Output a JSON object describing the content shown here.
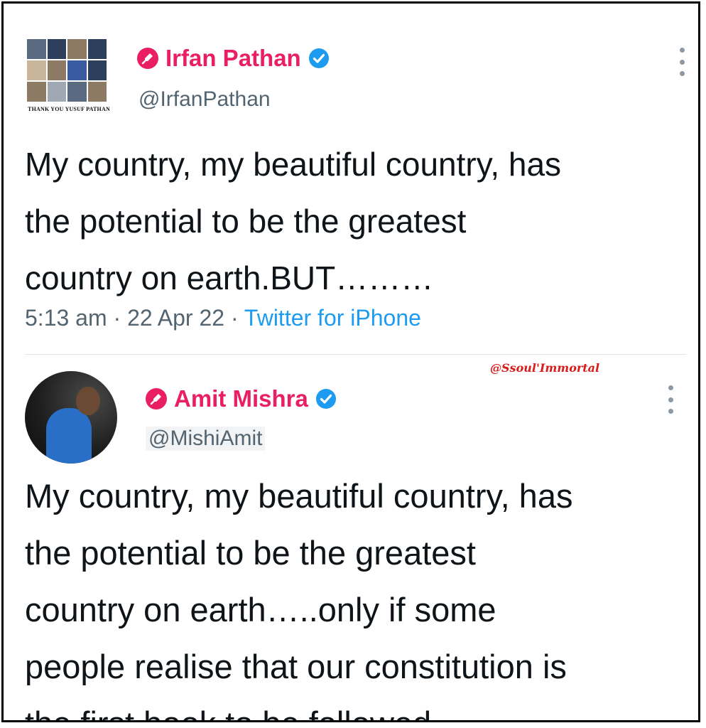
{
  "tweets": [
    {
      "display_name": "Irfan Pathan",
      "handle": "@IrfanPathan",
      "avatar_caption": "THANK YOU YUSUF PATHAN",
      "text_lines": [
        "My country, my beautiful country, has",
        "the potential to be the greatest",
        "country on earth.BUT………"
      ],
      "time": "5:13 am",
      "date": "22 Apr 22",
      "separator": "·",
      "source": "Twitter for iPhone"
    },
    {
      "display_name": "Amit Mishra",
      "handle": "@MishiAmit",
      "text_lines": [
        "My country, my beautiful country, has",
        "the potential to be the greatest",
        "country on earth…..only if some",
        "people realise that our constitution is",
        "the first book to be followed"
      ]
    }
  ],
  "watermark": "@Ssoul'Immortal",
  "colors": {
    "name_accent": "#e91e63",
    "verified": "#1d9bf0",
    "handle_gray": "#536471",
    "source_link": "#1d9bf0",
    "watermark": "#d81b1b"
  },
  "icons": [
    "pin-icon",
    "verified-icon",
    "more-icon"
  ]
}
